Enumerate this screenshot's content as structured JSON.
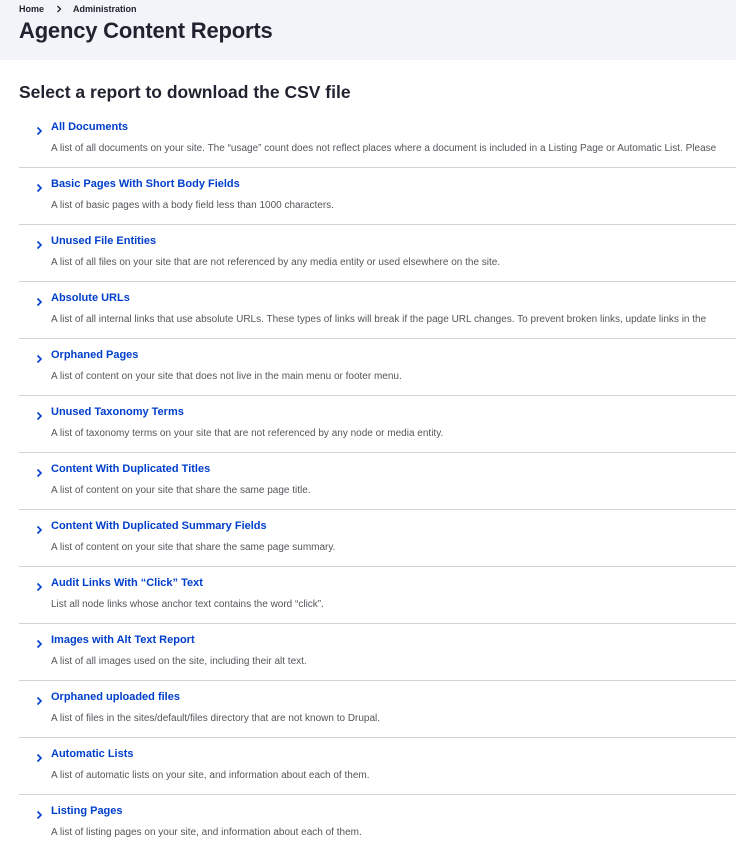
{
  "breadcrumb": {
    "home": "Home",
    "administration": "Administration"
  },
  "page_title": "Agency Content Reports",
  "section_heading": "Select a report to download the CSV file",
  "reports": [
    {
      "title": "All Documents",
      "description": "A list of all documents on your site. The “usage” count does not reflect places where a document is included in a Listing Page or Automatic List. Please"
    },
    {
      "title": "Basic Pages With Short Body Fields",
      "description": "A list of basic pages with a body field less than 1000 characters."
    },
    {
      "title": "Unused File Entities",
      "description": "A list of all files on your site that are not referenced by any media entity or used elsewhere on the site."
    },
    {
      "title": "Absolute URLs",
      "description": "A list of all internal links that use absolute URLs. These types of links will break if the page URL changes. To prevent broken links, update links in the"
    },
    {
      "title": "Orphaned Pages",
      "description": "A list of content on your site that does not live in the main menu or footer menu."
    },
    {
      "title": "Unused Taxonomy Terms",
      "description": "A list of taxonomy terms on your site that are not referenced by any node or media entity."
    },
    {
      "title": "Content With Duplicated Titles",
      "description": "A list of content on your site that share the same page title."
    },
    {
      "title": "Content With Duplicated Summary Fields",
      "description": "A list of content on your site that share the same page summary."
    },
    {
      "title": "Audit Links With “Click” Text",
      "description": "List all node links whose anchor text contains the word “click”."
    },
    {
      "title": "Images with Alt Text Report",
      "description": "A list of all images used on the site, including their alt text."
    },
    {
      "title": "Orphaned uploaded files",
      "description": "A list of files in the sites/default/files directory that are not known to Drupal."
    },
    {
      "title": "Automatic Lists",
      "description": "A list of automatic lists on your site, and information about each of them."
    },
    {
      "title": "Listing Pages",
      "description": "A list of listing pages on your site, and information about each of them."
    }
  ],
  "icons": {
    "breadcrumb_separator": "chevron-right-icon",
    "report_expander": "chevron-right-icon"
  },
  "colors": {
    "link": "#003ecc",
    "header_bg": "#f3f4f9",
    "divider": "#d3d4d9"
  }
}
